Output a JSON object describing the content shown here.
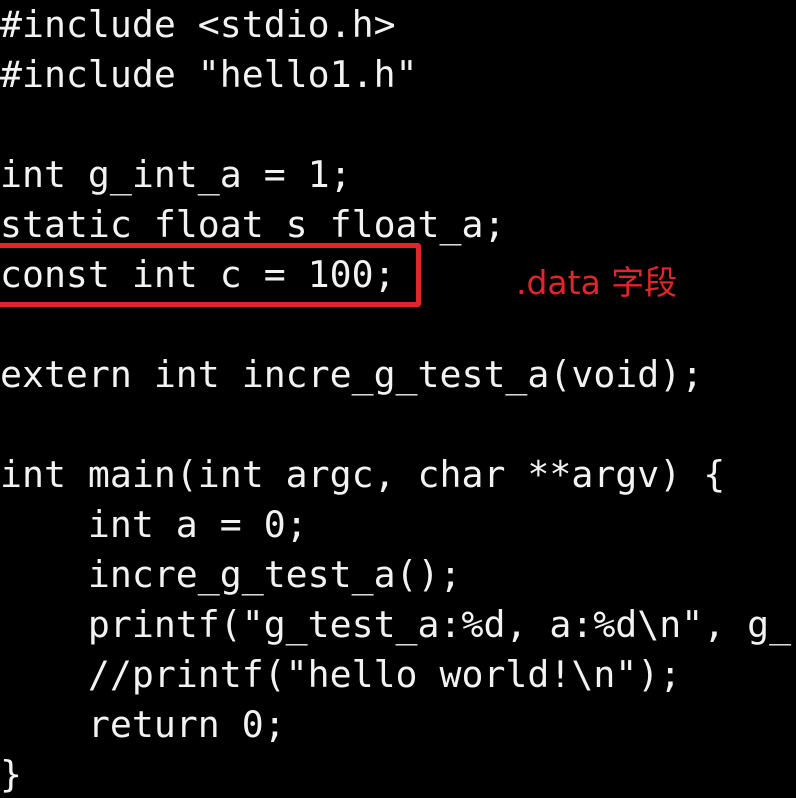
{
  "editor": {
    "lines": [
      "#include <stdio.h>",
      "#include \"hello1.h\"",
      "",
      "int g_int_a = 1;",
      "static float s_float_a;",
      "const int c = 100;",
      "",
      "extern int incre_g_test_a(void);",
      "",
      "int main(int argc, char **argv) {",
      "    int a = 0;",
      "    incre_g_test_a();",
      "    printf(\"g_test_a:%d, a:%d\\n\", g_",
      "    //printf(\"hello world!\\n\");",
      "    return 0;",
      "}"
    ]
  },
  "annotation": {
    "label": ".data 字段",
    "color": "#e0262a"
  }
}
